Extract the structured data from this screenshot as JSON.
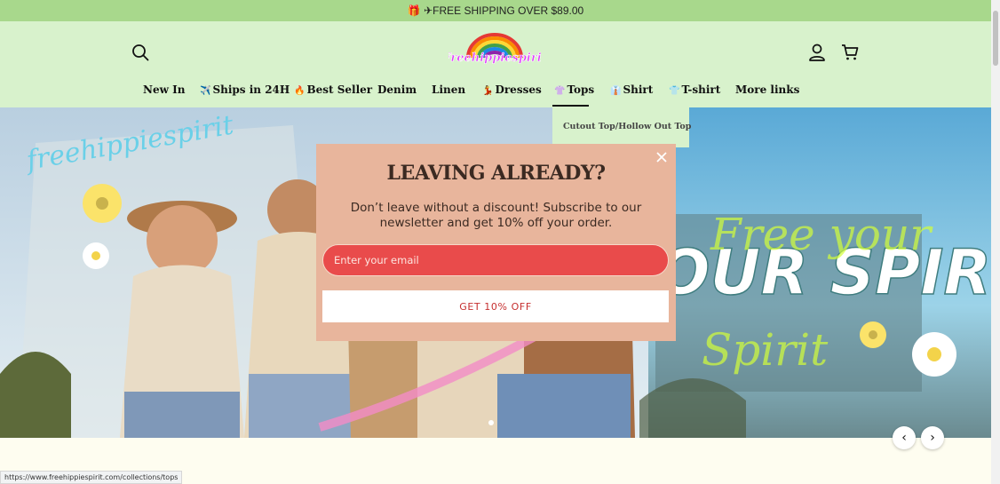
{
  "announcement": {
    "icon": "gift-icon",
    "text": "🎁 ✈FREE SHIPPING OVER $89.00"
  },
  "header": {
    "logo_text": "Freehippiespirit",
    "search_icon": "search-icon",
    "account_icon": "user-icon",
    "cart_icon": "cart-icon"
  },
  "nav": {
    "items": [
      {
        "label": "New In",
        "emoji": ""
      },
      {
        "label": "Ships in 24H",
        "emoji": "✈️"
      },
      {
        "label": "Best Seller",
        "emoji": "🔥"
      },
      {
        "label": "Denim",
        "emoji": ""
      },
      {
        "label": "Linen",
        "emoji": ""
      },
      {
        "label": "Dresses",
        "emoji": "💃"
      },
      {
        "label": "Tops",
        "emoji": "👚"
      },
      {
        "label": "Shirt",
        "emoji": "👔"
      },
      {
        "label": "T-shirt",
        "emoji": "👕"
      },
      {
        "label": "More links",
        "emoji": ""
      }
    ],
    "active": "Tops"
  },
  "dropdown": {
    "items": [
      "Cutout Top/Hollow Out Top"
    ]
  },
  "hero": {
    "script_text": "freehippiespirit",
    "headline": "OUR SPIRIT",
    "script_overlay": "Free your",
    "script_overlay_2": "Spirit"
  },
  "modal": {
    "title": "LEAVING ALREADY?",
    "text": "Don’t leave without a discount! Subscribe to our newsletter and get 10% off your order.",
    "email_placeholder": "Enter your email",
    "email_value": "",
    "button_label": "GET 10% OFF",
    "close_icon": "close-icon"
  },
  "carousel": {
    "prev_label": "‹",
    "next_label": "›"
  },
  "status_bar": {
    "url": "https://www.freehippiespirit.com/collections/tops"
  },
  "colors": {
    "announcement_bg": "#a8d88c",
    "header_bg": "#d8f2cc",
    "modal_bg": "#e8b59c",
    "input_bg": "#e94b4b",
    "cta_text": "#c62f2f"
  }
}
